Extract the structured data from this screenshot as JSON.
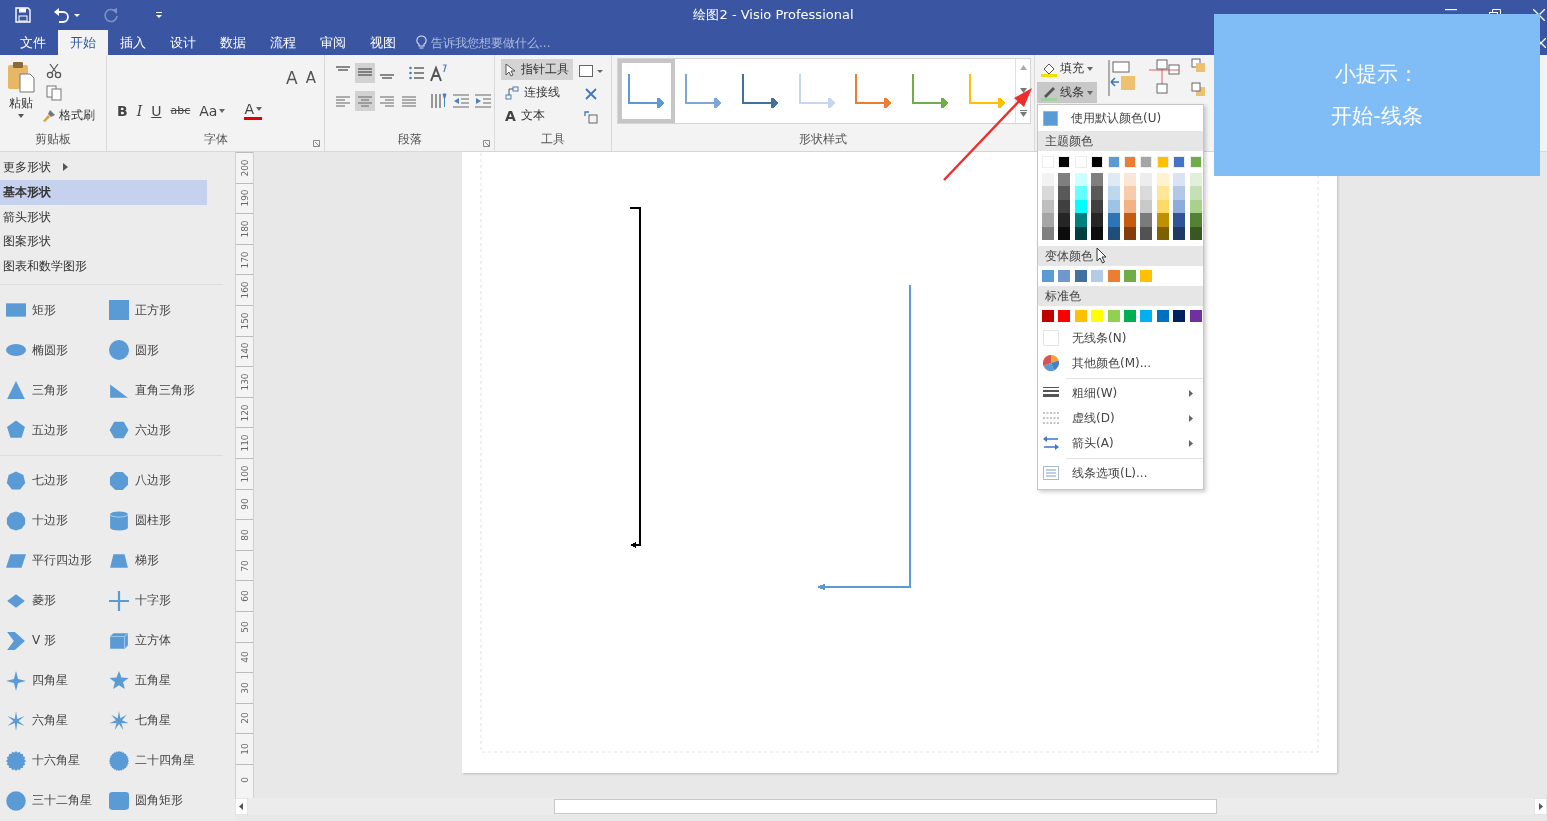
{
  "window": {
    "title": "绘图2 - Visio Professional"
  },
  "quick_access": [
    {
      "kind": "save",
      "disabled": false
    },
    {
      "kind": "undo",
      "disabled": false
    },
    {
      "kind": "redo",
      "disabled": true
    },
    {
      "kind": "customize",
      "disabled": false
    }
  ],
  "tabs": [
    {
      "label": "文件",
      "selected": false
    },
    {
      "label": "开始",
      "selected": true
    },
    {
      "label": "插入",
      "selected": false
    },
    {
      "label": "设计",
      "selected": false
    },
    {
      "label": "数据",
      "selected": false
    },
    {
      "label": "流程",
      "selected": false
    },
    {
      "label": "审阅",
      "selected": false
    },
    {
      "label": "视图",
      "selected": false
    }
  ],
  "tell_me": {
    "placeholder": "告诉我您想要做什么..."
  },
  "ribbon": {
    "clipboard": {
      "label": "剪贴板",
      "paste": "粘贴",
      "format_painter": "格式刷"
    },
    "font": {
      "label": "字体",
      "size_buttons": [
        "A",
        "A"
      ],
      "buttons": [
        {
          "kind": "bold",
          "text": "B"
        },
        {
          "kind": "italic",
          "text": "I"
        },
        {
          "kind": "underline",
          "text": "U"
        },
        {
          "kind": "strike",
          "text": "abc"
        },
        {
          "kind": "case",
          "text": "Aa"
        },
        {
          "kind": "color",
          "text": "A"
        }
      ]
    },
    "paragraph": {
      "label": "段落",
      "vertical_align": [
        {
          "kind": "top",
          "selected": false
        },
        {
          "kind": "middle",
          "selected": true
        },
        {
          "kind": "bottom",
          "selected": false
        }
      ],
      "horizontal_align": [
        {
          "kind": "left",
          "selected": false
        },
        {
          "kind": "center",
          "selected": true
        },
        {
          "kind": "right",
          "selected": false
        },
        {
          "kind": "justify",
          "selected": false
        }
      ]
    },
    "tools": {
      "label": "工具",
      "items": [
        {
          "kind": "pointer",
          "label": "指针工具",
          "selected": true
        },
        {
          "kind": "connector",
          "label": "连接线",
          "selected": false
        },
        {
          "kind": "text",
          "glyph": "A",
          "label": "文本",
          "selected": false
        }
      ]
    },
    "shape_styles": {
      "label": "形状样式",
      "styles": [
        {
          "color": "#5b9bd5",
          "selected": true
        },
        {
          "color": "#7fa6d8",
          "selected": false
        },
        {
          "color": "#41719c",
          "selected": false
        },
        {
          "color": "#c5d6ee",
          "selected": false
        },
        {
          "color": "#ed7d31",
          "selected": false
        },
        {
          "color": "#70ad47",
          "selected": false
        },
        {
          "color": "#ffc000",
          "selected": false
        }
      ]
    },
    "fill": {
      "label": "填充"
    },
    "line": {
      "label": "线条",
      "expanded": true
    }
  },
  "stencil": {
    "nav": [
      {
        "label": "更多形状",
        "submenu": true,
        "selected": false
      },
      {
        "label": "基本形状",
        "submenu": false,
        "selected": true
      },
      {
        "label": "箭头形状",
        "submenu": false,
        "selected": false
      },
      {
        "label": "图案形状",
        "submenu": false,
        "selected": false
      },
      {
        "label": "图表和数学图形",
        "submenu": false,
        "selected": false
      }
    ],
    "sections": [
      {
        "shapes": [
          {
            "label": "矩形",
            "kind": "rectangle"
          },
          {
            "label": "正方形",
            "kind": "square"
          },
          {
            "label": "椭圆形",
            "kind": "ellipse"
          },
          {
            "label": "圆形",
            "kind": "circle"
          },
          {
            "label": "三角形",
            "kind": "triangle"
          },
          {
            "label": "直角三角形",
            "kind": "right-triangle"
          },
          {
            "label": "五边形",
            "kind": "pentagon"
          },
          {
            "label": "六边形",
            "kind": "hexagon"
          }
        ]
      },
      {
        "shapes": [
          {
            "label": "七边形",
            "kind": "heptagon"
          },
          {
            "label": "八边形",
            "kind": "octagon"
          },
          {
            "label": "十边形",
            "kind": "decagon"
          },
          {
            "label": "圆柱形",
            "kind": "cylinder"
          },
          {
            "label": "平行四边形",
            "kind": "parallelogram"
          },
          {
            "label": "梯形",
            "kind": "trapezoid"
          },
          {
            "label": "菱形",
            "kind": "diamond"
          },
          {
            "label": "十字形",
            "kind": "cross"
          },
          {
            "label": "V 形",
            "kind": "chevron"
          },
          {
            "label": "立方体",
            "kind": "cube"
          },
          {
            "label": "四角星",
            "kind": "star4"
          },
          {
            "label": "五角星",
            "kind": "star5"
          },
          {
            "label": "六角星",
            "kind": "star6"
          },
          {
            "label": "七角星",
            "kind": "star7"
          },
          {
            "label": "十六角星",
            "kind": "star16"
          },
          {
            "label": "二十四角星",
            "kind": "star24"
          },
          {
            "label": "三十二角星",
            "kind": "star32"
          },
          {
            "label": "圆角矩形",
            "kind": "rounded-rectangle"
          }
        ]
      }
    ]
  },
  "ruler": [
    "200",
    "190",
    "180",
    "170",
    "160",
    "150",
    "140",
    "130",
    "120",
    "110",
    "100",
    "90",
    "80",
    "70",
    "60",
    "50",
    "40",
    "30",
    "20",
    "10",
    "0"
  ],
  "drawing": {
    "connectors": [
      {
        "color": "#000000"
      },
      {
        "color": "#5b9bd5"
      }
    ]
  },
  "line_menu": {
    "default_color": "使用默认颜色(U)",
    "theme_heading": "主题颜色",
    "theme_colors": [
      {
        "color": "#ffffff",
        "shades": [
          {
            "color": "#f2f2f2"
          },
          {
            "color": "#d9d9d9"
          },
          {
            "color": "#bfbfbf"
          },
          {
            "color": "#a6a6a6"
          },
          {
            "color": "#808080"
          }
        ]
      },
      {
        "color": "#000000",
        "shades": [
          {
            "color": "#7f7f7f"
          },
          {
            "color": "#595959"
          },
          {
            "color": "#404040"
          },
          {
            "color": "#262626"
          },
          {
            "color": "#0d0d0d"
          }
        ]
      },
      {
        "color": "#ffffff",
        "shades": [
          {
            "color": "#ccffff"
          },
          {
            "color": "#66ffff"
          },
          {
            "color": "#00ffff"
          },
          {
            "color": "#007f7f"
          },
          {
            "color": "#003f3f"
          }
        ]
      },
      {
        "color": "#000000",
        "shades": [
          {
            "color": "#7f7f7f"
          },
          {
            "color": "#595959"
          },
          {
            "color": "#404040"
          },
          {
            "color": "#262626"
          },
          {
            "color": "#0d0d0d"
          }
        ]
      },
      {
        "color": "#5b9bd5",
        "shades": [
          {
            "color": "#deebf7"
          },
          {
            "color": "#bdd7ee"
          },
          {
            "color": "#9dc3e6"
          },
          {
            "color": "#2e75b6"
          },
          {
            "color": "#1f4e79"
          }
        ]
      },
      {
        "color": "#ed7d31",
        "shades": [
          {
            "color": "#fbe5d6"
          },
          {
            "color": "#f8cbad"
          },
          {
            "color": "#f4b183"
          },
          {
            "color": "#c55a11"
          },
          {
            "color": "#843c0c"
          }
        ]
      },
      {
        "color": "#a5a5a5",
        "shades": [
          {
            "color": "#ededed"
          },
          {
            "color": "#dbdbdb"
          },
          {
            "color": "#c9c9c9"
          },
          {
            "color": "#7b7b7b"
          },
          {
            "color": "#525252"
          }
        ]
      },
      {
        "color": "#ffc000",
        "shades": [
          {
            "color": "#fff2cc"
          },
          {
            "color": "#ffe699"
          },
          {
            "color": "#ffd966"
          },
          {
            "color": "#bf9000"
          },
          {
            "color": "#7f6000"
          }
        ]
      },
      {
        "color": "#4472c4",
        "shades": [
          {
            "color": "#dae3f3"
          },
          {
            "color": "#b4c7e7"
          },
          {
            "color": "#8faadc"
          },
          {
            "color": "#2f5597"
          },
          {
            "color": "#203864"
          }
        ]
      },
      {
        "color": "#70ad47",
        "shades": [
          {
            "color": "#e2f0d9"
          },
          {
            "color": "#c5e0b4"
          },
          {
            "color": "#a9d18e"
          },
          {
            "color": "#548235"
          },
          {
            "color": "#385723"
          }
        ]
      }
    ],
    "variant_heading": "变体颜色",
    "variant_colors": [
      {
        "color": "#5b9bd5"
      },
      {
        "color": "#7197cf"
      },
      {
        "color": "#41719c"
      },
      {
        "color": "#b4cbe8"
      },
      {
        "color": "#ed7d31"
      },
      {
        "color": "#70ad47"
      },
      {
        "color": "#ffc000"
      }
    ],
    "standard_heading": "标准色",
    "standard_colors": [
      {
        "color": "#c00000"
      },
      {
        "color": "#ff0000"
      },
      {
        "color": "#ffc000"
      },
      {
        "color": "#ffff00"
      },
      {
        "color": "#92d050"
      },
      {
        "color": "#00b050"
      },
      {
        "color": "#00b0f0"
      },
      {
        "color": "#0070c0"
      },
      {
        "color": "#002060"
      },
      {
        "color": "#7030a0"
      }
    ],
    "items": [
      {
        "kind": "no-line",
        "label": "无线条(N)",
        "submenu": false
      },
      {
        "kind": "more-colors",
        "label": "其他颜色(M)...",
        "submenu": false
      },
      {
        "kind": "weight",
        "label": "粗细(W)",
        "submenu": true
      },
      {
        "kind": "dashes",
        "label": "虚线(D)",
        "submenu": true
      },
      {
        "kind": "arrows",
        "label": "箭头(A)",
        "submenu": true
      },
      {
        "kind": "options",
        "label": "线条选项(L)...",
        "submenu": false
      }
    ]
  },
  "tip": {
    "title": "小提示：",
    "text": "开始-线条"
  }
}
